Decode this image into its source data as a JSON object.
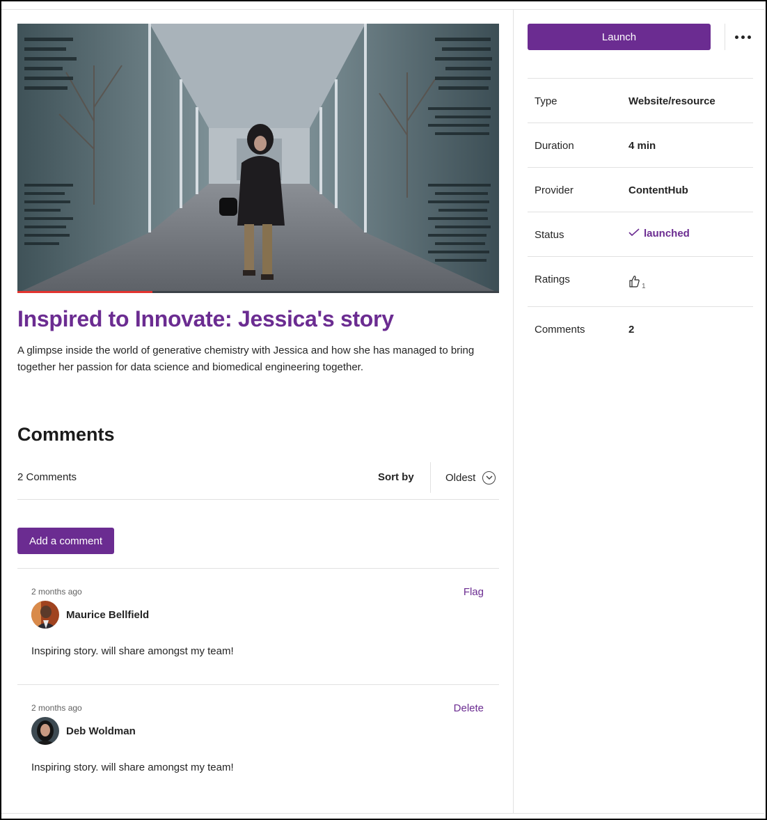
{
  "hero": {
    "video_progress": 0.28,
    "colors": {
      "progress": "#e3342f"
    }
  },
  "course": {
    "title": "Inspired to Innovate: Jessica's story",
    "description": "A glimpse inside the world of generative chemistry with Jessica and how she has managed to bring together her passion for data science and biomedical engineering together."
  },
  "comments_section": {
    "heading": "Comments",
    "count_label": "2 Comments",
    "sort_label": "Sort by",
    "sort_value": "Oldest",
    "add_button": "Add a comment",
    "items": [
      {
        "time": "2 months ago",
        "author": "Maurice Bellfield",
        "action": "Flag",
        "text": "Inspiring story. will share amongst my team!"
      },
      {
        "time": "2 months ago",
        "author": "Deb Woldman",
        "action": "Delete",
        "text": "Inspiring story. will share amongst my team!"
      }
    ]
  },
  "sidebar": {
    "launch_label": "Launch",
    "more_icon": "more-horizontal-icon",
    "properties": [
      {
        "key": "Type",
        "value": "Website/resource"
      },
      {
        "key": "Duration",
        "value": "4 min"
      },
      {
        "key": "Provider",
        "value": "ContentHub"
      },
      {
        "key": "Status",
        "value": "launched",
        "icon": "checkmark-icon"
      },
      {
        "key": "Ratings",
        "value": "1",
        "icon": "thumbs-up-icon"
      },
      {
        "key": "Comments",
        "value": "2"
      }
    ]
  },
  "colors": {
    "accent": "#6b2c91",
    "text": "#242424",
    "divider": "#e1e1e1"
  }
}
